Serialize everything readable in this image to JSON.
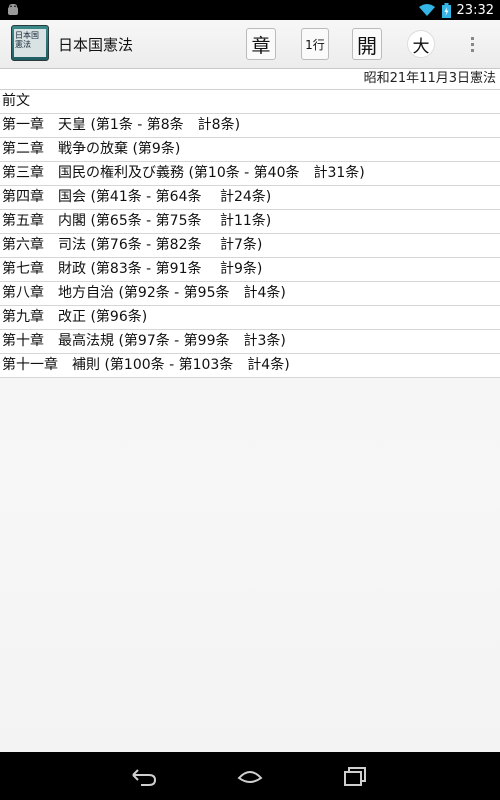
{
  "status_bar": {
    "time": "23:32",
    "icons": [
      "android-icon",
      "wifi-icon",
      "battery-icon"
    ]
  },
  "action_bar": {
    "app_icon_text": "日本国憲法",
    "title": "日本国憲法",
    "buttons": {
      "chapter": "章",
      "line": "1行",
      "open": "開",
      "large": "大"
    }
  },
  "content": {
    "subtitle": "昭和21年11月3日憲法",
    "items": [
      {
        "label": "前文"
      },
      {
        "label": "第一章　天皇 (第1条 - 第8条　計8条)"
      },
      {
        "label": "第二章　戦争の放棄 (第9条)"
      },
      {
        "label": "第三章　国民の権利及び義務 (第10条 - 第40条　計31条)"
      },
      {
        "label": "第四章　国会 (第41条 - 第64条　 計24条)"
      },
      {
        "label": "第五章　内閣 (第65条 - 第75条　 計11条)"
      },
      {
        "label": "第六章　司法 (第76条 - 第82条　 計7条)"
      },
      {
        "label": "第七章　財政 (第83条 - 第91条　 計9条)"
      },
      {
        "label": "第八章　地方自治 (第92条 - 第95条　計4条)"
      },
      {
        "label": "第九章　改正 (第96条)"
      },
      {
        "label": "第十章　最高法規 (第97条 - 第99条　計3条)"
      },
      {
        "label": "第十一章　補則 (第100条 - 第103条　計4条)"
      }
    ]
  },
  "colors": {
    "status_bar": "#000000",
    "action_bar": "#f0f0f0",
    "app_icon": "#2f7a7c",
    "battery_accent": "#33b5e5"
  }
}
